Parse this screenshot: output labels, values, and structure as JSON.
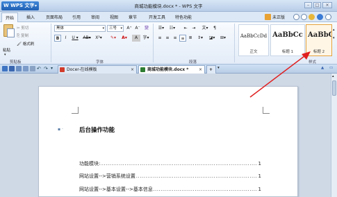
{
  "app": {
    "name": "WPS 文字",
    "window_title": "商城功能模块.docx * - WPS 文字"
  },
  "menu": {
    "items": [
      "开始",
      "插入",
      "页面布局",
      "引用",
      "审阅",
      "视图",
      "章节",
      "开发工具",
      "特色功能"
    ],
    "right_label": "未正版"
  },
  "ribbon": {
    "clipboard": {
      "cut": "剪切",
      "copy": "复制",
      "paste": "粘贴",
      "format_painter": "格式刷",
      "group": "剪贴板"
    },
    "font": {
      "name": "黑体",
      "size": "三号",
      "group": "字体"
    },
    "paragraph": {
      "group": "段落"
    },
    "styles": {
      "group": "样式",
      "items": [
        {
          "sample": "AaBbCcDd",
          "name": "正文"
        },
        {
          "sample": "AaBbCc",
          "name": "标题 1"
        },
        {
          "sample": "AaBbC",
          "name": "标题 2"
        }
      ]
    }
  },
  "tabs": [
    {
      "label": "Docer-在线模板"
    },
    {
      "label": "商城功能模块.docx *"
    }
  ],
  "document": {
    "heading": "后台操作功能",
    "toc": [
      {
        "text": "功能模块:",
        "page": "1"
      },
      {
        "text": "网站设置-->营销系统设置",
        "page": "1"
      },
      {
        "text": "网站设置-->基本设置-->基本信息",
        "page": "1"
      }
    ]
  },
  "colors": {
    "accent": "#1f5fb3",
    "arrow": "#e02020",
    "selected_style": "#e6a23c"
  }
}
